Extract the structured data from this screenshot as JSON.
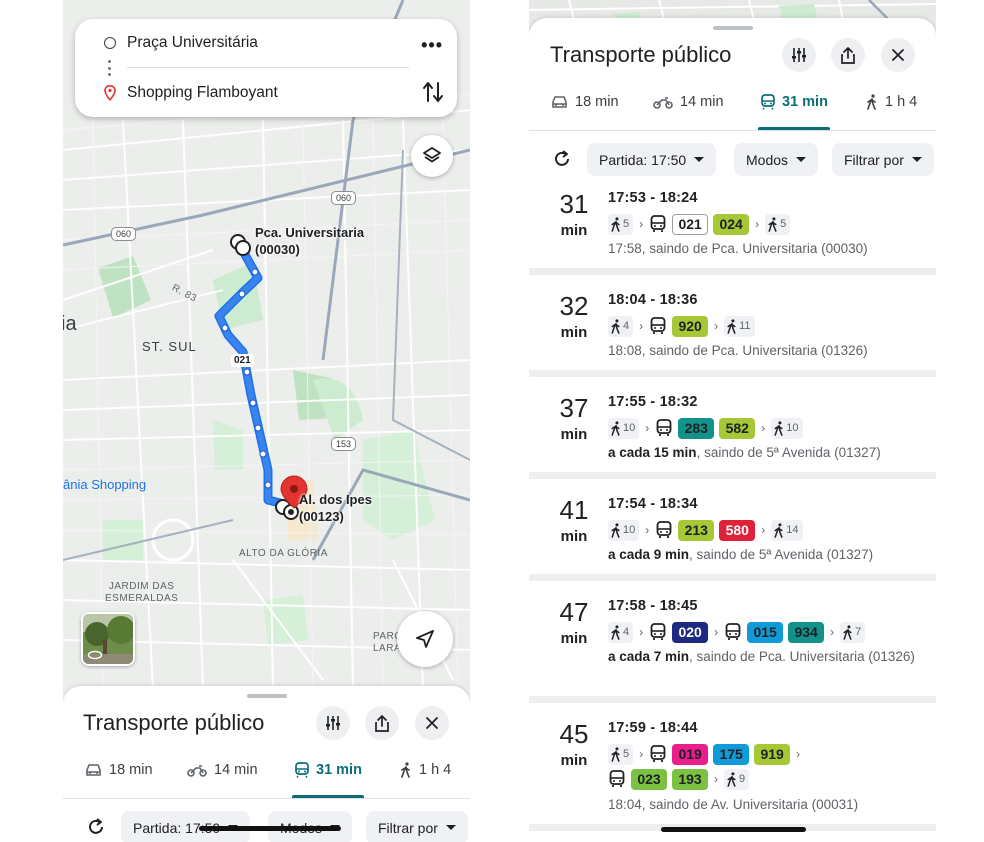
{
  "left": {
    "search": {
      "origin": "Praça Universitária",
      "destination": "Shopping Flamboyant"
    },
    "map": {
      "labels": {
        "stop_origin_line1": "Pca. Universitaria",
        "stop_origin_line2": "(00030)",
        "stop_dest_line1": "Al. dos Ipes",
        "stop_dest_line2": "(00123)",
        "route": "021",
        "city_part": "ia",
        "st_sul": "ST. SUL",
        "r83": "R. 83",
        "alto": "ALTO DA GLÓRIA",
        "jardim_line1": "JARDIM DAS",
        "jardim_line2": "ESMERALDAS",
        "parque_line1": "PARQUE",
        "parque_line2": "LARANJEIRAS",
        "shopping": "ânia Shopping",
        "road_060_a": "060",
        "road_060_b": "060",
        "road_153": "153"
      }
    },
    "sheet": {
      "title": "Transporte público",
      "tabs": [
        {
          "label": "18 min",
          "icon": "car-icon"
        },
        {
          "label": "14 min",
          "icon": "motorcycle-icon"
        },
        {
          "label": "31 min",
          "icon": "transit-icon",
          "active": true
        },
        {
          "label": "1 h 4",
          "icon": "walk-icon"
        }
      ],
      "chips": {
        "departure": "Partida: 17:50",
        "modes": "Modos",
        "filter": "Filtrar por"
      }
    }
  },
  "right": {
    "sheet": {
      "title": "Transporte público",
      "tabs": [
        {
          "label": "18 min",
          "icon": "car-icon"
        },
        {
          "label": "14 min",
          "icon": "motorcycle-icon"
        },
        {
          "label": "31 min",
          "icon": "transit-icon",
          "active": true
        },
        {
          "label": "1 h 4",
          "icon": "walk-icon"
        }
      ],
      "chips": {
        "departure": "Partida: 17:50",
        "modes": "Modos",
        "filter": "Filtrar por"
      }
    },
    "duration_unit": "min",
    "trips": [
      {
        "duration": "31",
        "time_range": "17:53 - 18:24",
        "legs": [
          {
            "type": "walk",
            "minutes": "5"
          },
          {
            "type": "bus",
            "lines": [
              {
                "name": "021",
                "bg": "#ffffff",
                "fg": "#202124",
                "border": "#9aa0a6"
              },
              {
                "name": "024",
                "bg": "#a6c736",
                "fg": "#202124"
              }
            ]
          },
          {
            "type": "walk",
            "minutes": "5"
          }
        ],
        "info_bold": "",
        "info_rest": "17:58, saindo de Pca. Universitaria (00030)"
      },
      {
        "duration": "32",
        "time_range": "18:04 - 18:36",
        "legs": [
          {
            "type": "walk",
            "minutes": "4"
          },
          {
            "type": "bus",
            "lines": [
              {
                "name": "920",
                "bg": "#a6c736",
                "fg": "#202124"
              }
            ]
          },
          {
            "type": "walk",
            "minutes": "11"
          }
        ],
        "info_bold": "",
        "info_rest": "18:08, saindo de Pca. Universitaria (01326)"
      },
      {
        "duration": "37",
        "time_range": "17:55 - 18:32",
        "legs": [
          {
            "type": "walk",
            "minutes": "10"
          },
          {
            "type": "bus",
            "lines": [
              {
                "name": "283",
                "bg": "#12928a",
                "fg": "#202124"
              },
              {
                "name": "582",
                "bg": "#a6c736",
                "fg": "#202124"
              }
            ]
          },
          {
            "type": "walk",
            "minutes": "10"
          }
        ],
        "info_bold": "a cada 15 min",
        "info_rest": ", saindo de 5ª Avenida (01327)"
      },
      {
        "duration": "41",
        "time_range": "17:54 - 18:34",
        "legs": [
          {
            "type": "walk",
            "minutes": "10"
          },
          {
            "type": "bus",
            "lines": [
              {
                "name": "213",
                "bg": "#a6c736",
                "fg": "#202124"
              },
              {
                "name": "580",
                "bg": "#e0213a",
                "fg": "#ffffff"
              }
            ]
          },
          {
            "type": "walk",
            "minutes": "14"
          }
        ],
        "info_bold": "a cada 9 min",
        "info_rest": ", saindo de 5ª Avenida (01327)"
      },
      {
        "duration": "47",
        "time_range": "17:58 - 18:45",
        "legs": [
          {
            "type": "walk",
            "minutes": "4"
          },
          {
            "type": "bus",
            "lines": [
              {
                "name": "020",
                "bg": "#1d2a80",
                "fg": "#ffffff"
              }
            ]
          },
          {
            "type": "bus",
            "lines": [
              {
                "name": "015",
                "bg": "#0f9ad8",
                "fg": "#202124"
              },
              {
                "name": "934",
                "bg": "#12928a",
                "fg": "#202124"
              }
            ]
          },
          {
            "type": "walk",
            "minutes": "7"
          }
        ],
        "info_bold": "a cada 7 min",
        "info_rest": ", saindo de Pca. Universitaria (01326)"
      },
      {
        "duration": "45",
        "time_range": "17:59 - 18:44",
        "legs": [
          {
            "type": "walk",
            "minutes": "5"
          },
          {
            "type": "bus",
            "lines": [
              {
                "name": "019",
                "bg": "#e91e8c",
                "fg": "#202124"
              },
              {
                "name": "175",
                "bg": "#0f9ad8",
                "fg": "#202124"
              },
              {
                "name": "919",
                "bg": "#a6c736",
                "fg": "#202124"
              }
            ]
          }
        ],
        "legs_row2": [
          {
            "type": "bus",
            "lines": [
              {
                "name": "023",
                "bg": "#7bc142",
                "fg": "#202124"
              },
              {
                "name": "193",
                "bg": "#7bc142",
                "fg": "#202124"
              }
            ]
          },
          {
            "type": "walk",
            "minutes": "9"
          }
        ],
        "info_bold": "",
        "info_rest": "18:04, saindo de Av. Universitaria (00031)"
      }
    ]
  },
  "colors": {
    "accent": "#0b6e77",
    "route_blue": "#1a73e8",
    "pin_red": "#e3342f"
  }
}
